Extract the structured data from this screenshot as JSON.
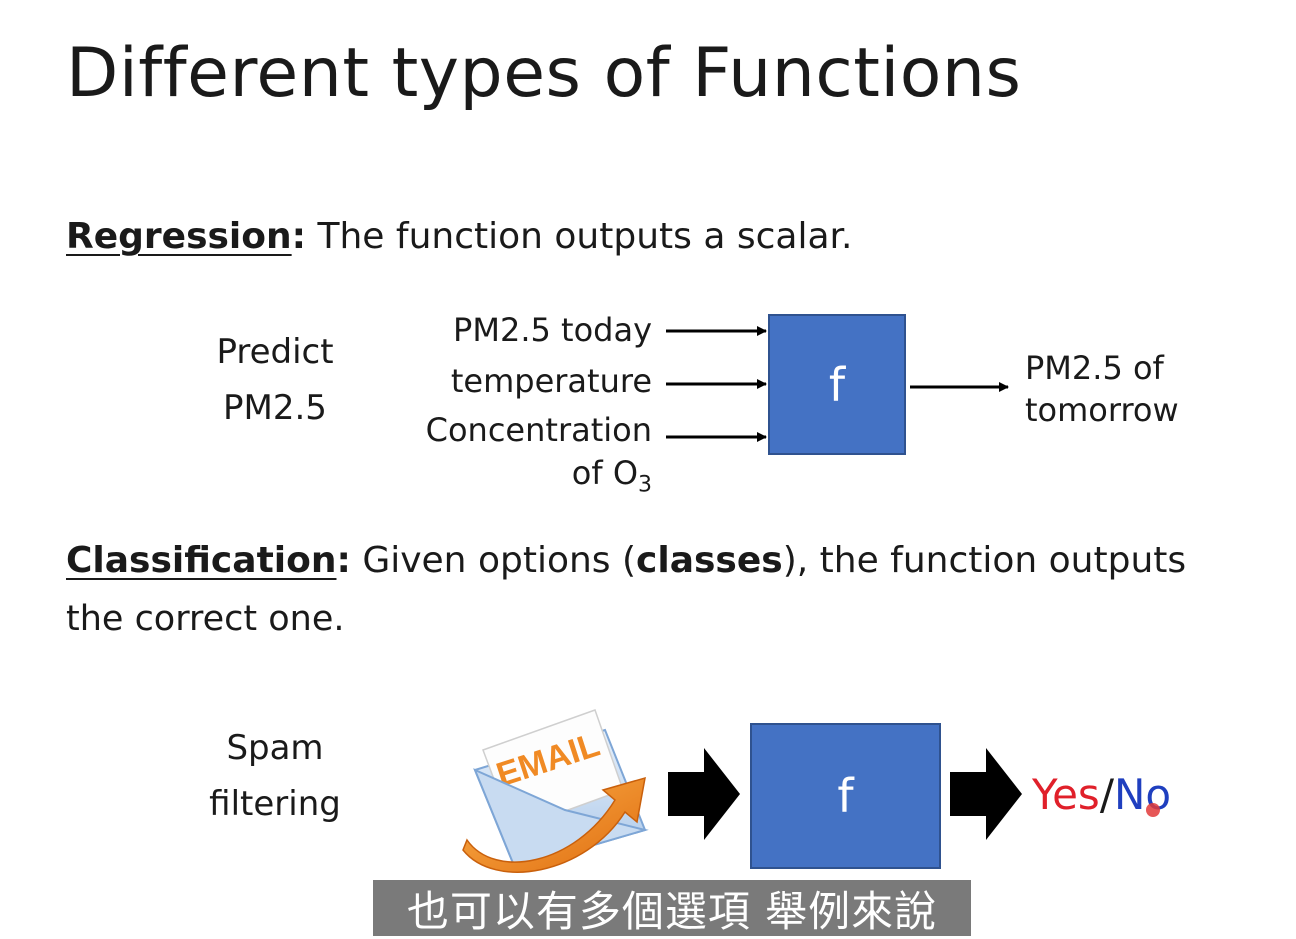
{
  "slide": {
    "title": "Different types of Functions"
  },
  "regression": {
    "term": "Regression",
    "colon": ":",
    "description": " The function outputs a scalar.",
    "task_line1": "Predict",
    "task_line2": "PM2.5",
    "inputs": [
      "PM2.5 today",
      "temperature",
      "Concentration"
    ],
    "input_last_prefix": "of O",
    "input_last_sub": "3",
    "function_label": "f",
    "output_line1": "PM2.5 of",
    "output_line2": "tomorrow"
  },
  "classification": {
    "term": "Classification",
    "colon": ":",
    "text_before_bold": " Given options (",
    "bold_word": "classes",
    "text_after_bold": "), the function outputs",
    "line2": "the correct one.",
    "task_line1": "Spam",
    "task_line2": "filtering",
    "email_label": "EMAIL",
    "function_label": "f",
    "output_yes": "Yes",
    "output_sep": "/",
    "output_no": "No"
  },
  "subtitle": "也可以有多個選項 舉例來說",
  "colors": {
    "function_box": "#4472c4",
    "yes": "#e0202a",
    "no": "#1f3fbf",
    "email_orange": "#f08a24",
    "subtitle_bg": "#7a7a7a"
  },
  "icons": [
    "email-envelope-icon",
    "arrow-right-icon",
    "block-arrow-right-icon"
  ]
}
